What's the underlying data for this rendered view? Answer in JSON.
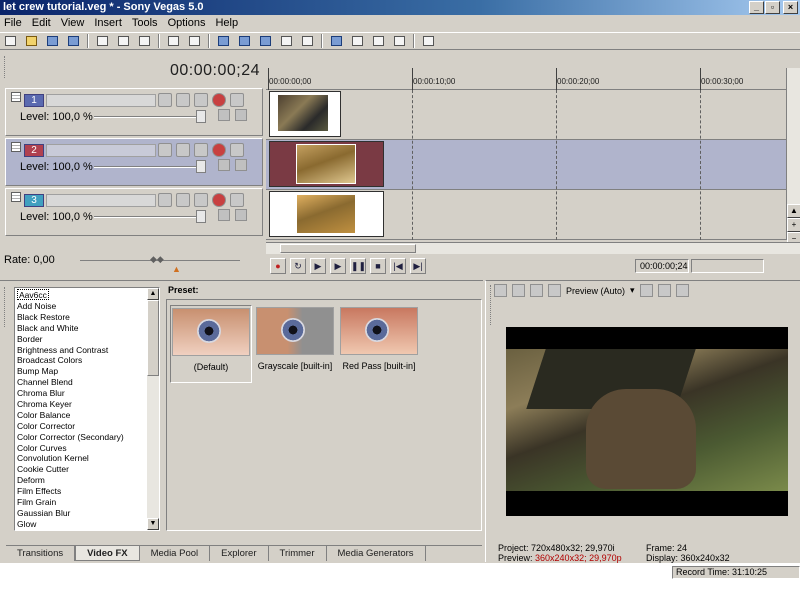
{
  "app": {
    "title": "let crew tutorial.veg * - Sony Vegas 5.0",
    "window_buttons": [
      "_",
      "▫",
      "×"
    ]
  },
  "menu": [
    "File",
    "Edit",
    "View",
    "Insert",
    "Tools",
    "Options",
    "Help"
  ],
  "toolbar_icons": [
    "new-icon",
    "open-icon",
    "save-icon",
    "save-as-icon",
    "cut-icon",
    "copy-icon",
    "paste-icon",
    "undo-icon",
    "redo-icon",
    "ripple-icon",
    "auto-crossfade-icon",
    "snap-icon",
    "normal-edit-icon",
    "envelope-icon",
    "selection-icon",
    "zoom-icon",
    "scrub-icon",
    "help-icon"
  ],
  "timeline": {
    "cursor_time": "00:00:00;24",
    "ruler_labels": [
      "00:00:00;00",
      "00:00:10;00",
      "00:00:20;00",
      "00:00:30;00"
    ],
    "tracks": [
      {
        "number": "1",
        "level": "Level: 100,0 %"
      },
      {
        "number": "2",
        "level": "Level: 100,0 %"
      },
      {
        "number": "3",
        "level": "Level: 100,0 %"
      }
    ]
  },
  "transport": {
    "rate": "Rate: 0,00",
    "position": "00:00:00;24"
  },
  "fx": {
    "items": [
      "Aav6cc",
      "Add Noise",
      "Black Restore",
      "Black and White",
      "Border",
      "Brightness and Contrast",
      "Broadcast Colors",
      "Bump Map",
      "Channel Blend",
      "Chroma Blur",
      "Chroma Keyer",
      "Color Balance",
      "Color Corrector",
      "Color Corrector (Secondary)",
      "Color Curves",
      "Convolution Kernel",
      "Cookie Cutter",
      "Deform",
      "Film Effects",
      "Film Grain",
      "Gaussian Blur",
      "Glow"
    ],
    "preset_label": "Preset:",
    "presets": [
      "(Default)",
      "Grayscale [built-in]",
      "Red Pass [built-in]"
    ]
  },
  "tabs": [
    "Transitions",
    "Video FX",
    "Media Pool",
    "Explorer",
    "Trimmer",
    "Media Generators"
  ],
  "preview": {
    "mode": "Preview (Auto)",
    "project_label": "Project:",
    "project_value": "720x480x32; 29,970i",
    "preview_label": "Preview:",
    "preview_value": "360x240x32; 29,970p",
    "frame_label": "Frame:",
    "frame_value": "24",
    "display_label": "Display:",
    "display_value": "360x240x32"
  },
  "status": {
    "record_time": "Record Time: 31:10:25"
  },
  "colors": {
    "track_selected": "#b0b4cc",
    "clip2_bg": "#7a3a44",
    "titlebar": "#0a246a",
    "preview_red": "#b00000"
  }
}
